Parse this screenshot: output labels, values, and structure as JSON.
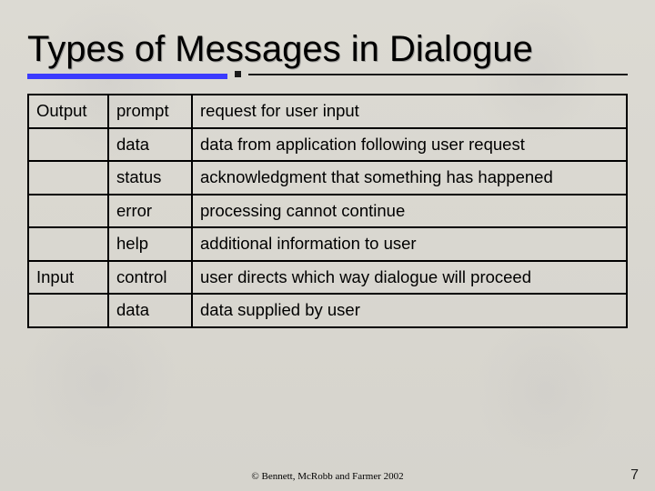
{
  "title": "Types of Messages in Dialogue",
  "categories": {
    "output": "Output",
    "input": "Input"
  },
  "rows": [
    {
      "cat": "output",
      "type": "prompt",
      "desc": "request for user input"
    },
    {
      "cat": "",
      "type": "data",
      "desc": "data from application following user request"
    },
    {
      "cat": "",
      "type": "status",
      "desc": "acknowledgment that something has happened"
    },
    {
      "cat": "",
      "type": "error",
      "desc": "processing cannot continue"
    },
    {
      "cat": "",
      "type": "help",
      "desc": "additional information to user"
    },
    {
      "cat": "input",
      "type": "control",
      "desc": "user directs which way dialogue will proceed"
    },
    {
      "cat": "",
      "type": "data",
      "desc": "data supplied by user"
    }
  ],
  "footer": "©  Bennett, McRobb and Farmer 2002",
  "page_number": "7"
}
